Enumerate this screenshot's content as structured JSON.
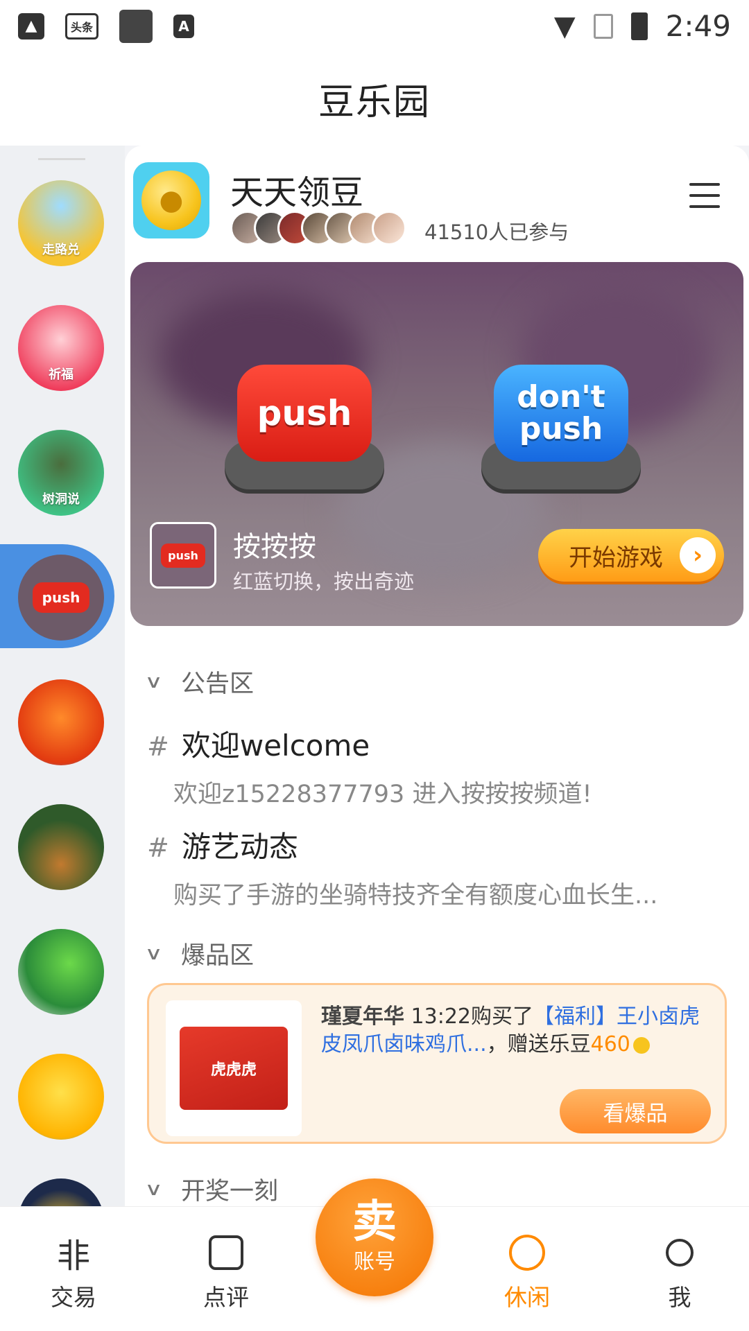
{
  "status_bar": {
    "time": "2:49",
    "notif_text": "头条"
  },
  "header": {
    "title": "豆乐园"
  },
  "sidebar": {
    "items": [
      {
        "label": "走路兑"
      },
      {
        "label": "祈福"
      },
      {
        "label": "树洞说"
      },
      {
        "label": "push"
      },
      {
        "label": ""
      },
      {
        "label": ""
      },
      {
        "label": ""
      },
      {
        "label": ""
      }
    ]
  },
  "app": {
    "title": "天天领豆",
    "participants": "41510人已参与"
  },
  "banner": {
    "push_label": "push",
    "dont_push_label": "don't push",
    "game_thumb_label": "push",
    "game_name": "按按按",
    "game_desc": "红蓝切换，按出奇迹",
    "start_label": "开始游戏"
  },
  "sections": {
    "notice_title": "公告区",
    "hot_title": "爆品区",
    "lottery_title": "开奖一刻"
  },
  "notices": [
    {
      "title": "欢迎welcome",
      "desc": "欢迎z15228377793 进入按按按频道!"
    },
    {
      "title": "游艺动态",
      "desc": "购买了手游的坐骑特技齐全有额度心血长生..."
    }
  ],
  "hot": {
    "user": "瑾夏年华",
    "text1": " 13:22购买了",
    "product": "【福利】王小卤虎皮凤爪卤味鸡爪...",
    "text2": "，赠送乐豆",
    "beans": "460",
    "button": "看爆品",
    "package_text": "虎虎虎"
  },
  "tabbar": {
    "items": [
      {
        "label": "交易",
        "icon": "trade-icon"
      },
      {
        "label": "点评",
        "icon": "review-icon"
      },
      {
        "label": "休闲",
        "icon": "leisure-icon",
        "active": true
      },
      {
        "label": "我",
        "icon": "profile-icon"
      }
    ],
    "sell_big": "卖",
    "sell_small": "账号"
  },
  "colors": {
    "accent": "#ff8a00",
    "sidebar_active": "#4a90e2",
    "link": "#2f6fe0"
  }
}
